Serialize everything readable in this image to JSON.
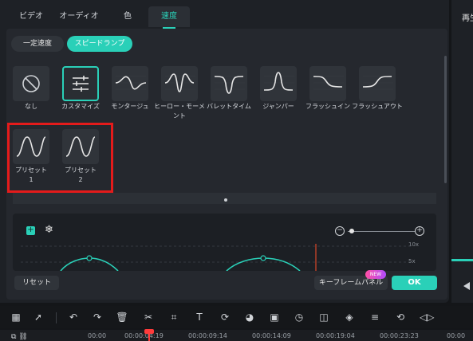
{
  "tabs": [
    {
      "label": "ビデオ"
    },
    {
      "label": "オーディオ"
    },
    {
      "label": "色"
    },
    {
      "label": "速度"
    }
  ],
  "active_tab": "速度",
  "right_panel_title": "再生",
  "subtabs": [
    {
      "label": "一定速度"
    },
    {
      "label": "スピードランプ"
    }
  ],
  "presets": [
    {
      "label": "なし",
      "icon": "none-icon"
    },
    {
      "label": "カスタマイズ",
      "icon": "sliders-icon"
    },
    {
      "label": "モンタージュ",
      "icon": "montage-curve-icon"
    },
    {
      "label": "ヒーロー・モーメント",
      "icon": "hero-moment-curve-icon"
    },
    {
      "label": "バレットタイム",
      "icon": "bullet-time-curve-icon"
    },
    {
      "label": "ジャンパー",
      "icon": "jumper-curve-icon"
    },
    {
      "label": "フラッシュイン",
      "icon": "flash-in-curve-icon"
    },
    {
      "label": "フラッシュアウト",
      "icon": "flash-out-curve-icon"
    }
  ],
  "user_presets": [
    {
      "label_line1": "プリセット",
      "label_line2": "1"
    },
    {
      "label_line1": "プリセット",
      "label_line2": "2"
    }
  ],
  "editor": {
    "grid_top_label": "10x",
    "grid_mid_label": "5x"
  },
  "buttons": {
    "reset": "リセット",
    "keyframe_panel": "キーフレームパネル",
    "new_badge": "NEW",
    "ok": "OK"
  },
  "timecodes": [
    "00:00",
    "00:00:04:19",
    "00:00:09:14",
    "00:00:14:09",
    "00:00:19:04",
    "00:00:23:23",
    "00:00"
  ],
  "colors": {
    "accent": "#2ad0b8",
    "highlight": "#e41b1b",
    "playhead": "#ff3b3b"
  }
}
